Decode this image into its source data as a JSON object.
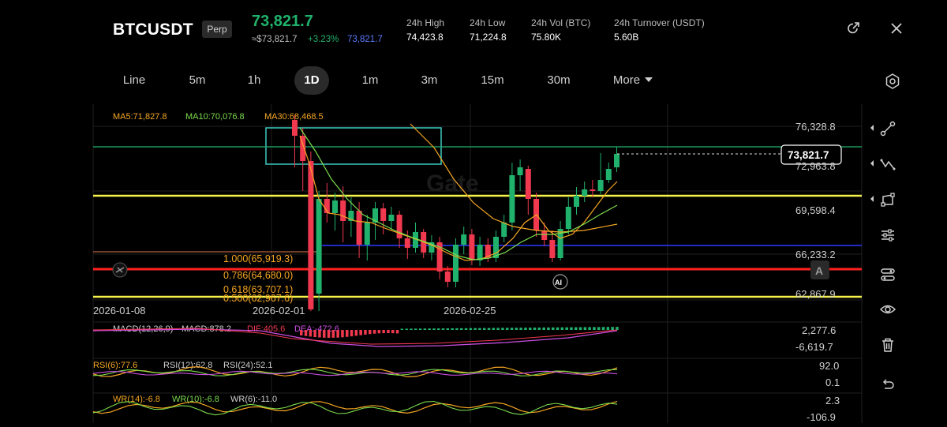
{
  "header": {
    "symbol": "BTCUSDT",
    "contract_type": "Perp",
    "last_price": "73,821.7",
    "approx_price": "≈$73,821.7",
    "change_pct": "+3.23%",
    "mark_price": "73,821.7",
    "stats": [
      {
        "label": "24h  High",
        "value": "74,423.8"
      },
      {
        "label": "24h  Low",
        "value": "71,224.8"
      },
      {
        "label": "24h  Vol (BTC)",
        "value": "75.80K"
      },
      {
        "label": "24h  Turnover (USDT)",
        "value": "5.60B"
      }
    ],
    "icons": {
      "share": "external-link-icon",
      "close": "close-icon"
    }
  },
  "intervals": {
    "items": [
      "Line",
      "5m",
      "1h",
      "1D",
      "1m",
      "3m",
      "15m",
      "30m"
    ],
    "active": "1D",
    "more_label": "More"
  },
  "main_chart": {
    "ma_labels": [
      {
        "text": "MA5:71,827.8",
        "color": "#f5a623"
      },
      {
        "text": "MA10:70,076.8",
        "color": "#7bdc4c"
      },
      {
        "text": "MA30:68,468.5",
        "color": "#f5a623"
      }
    ],
    "price_axis": [
      "76,328.8",
      "72,963.8",
      "69,598.4",
      "66,233.2",
      "62,867.9"
    ],
    "current_price_tag": "73,821.7",
    "date_axis": [
      "2026-01-08",
      "2026-02-01",
      "2026-02-25"
    ],
    "fib_labels": [
      "1.000(65,919.3)",
      "0.786(64,680.0)",
      "0.618(63,707.1)",
      "0.500(62,967.6)"
    ],
    "watermark": "Gate",
    "ai_badge": "AI",
    "a_badge": "A",
    "colors": {
      "up": "#20b26c",
      "down": "#f0394f",
      "ma5": "#f5a623",
      "ma10": "#7bdc4c"
    }
  },
  "macd_panel": {
    "labels": [
      {
        "text": "MACD(12,26,9)",
        "color": "#cfcfcf"
      },
      {
        "text": "MACD:878.2",
        "color": "#cfcfcf"
      },
      {
        "text": "DIF:405.6",
        "color": "#f0394f"
      },
      {
        "text": "DEA:-472.6",
        "color": "#c94ee0"
      }
    ],
    "axis": [
      "2,277.6",
      "-6,619.7"
    ]
  },
  "rsi_panel": {
    "labels": [
      {
        "text": "RSI(6):77.6",
        "color": "#f5a623"
      },
      {
        "text": "RSI(12):62.8",
        "color": "#cfcfcf"
      },
      {
        "text": "RSI(24):52.1",
        "color": "#cfcfcf"
      }
    ],
    "axis": [
      "92.0",
      "0.1"
    ]
  },
  "wr_panel": {
    "labels": [
      {
        "text": "WR(14):-6.8",
        "color": "#f5a623"
      },
      {
        "text": "WR(10):-6.8",
        "color": "#7bdc4c"
      },
      {
        "text": "WR(6):-11.0",
        "color": "#cfcfcf"
      }
    ],
    "axis": [
      "2.3",
      "-106.9"
    ]
  },
  "drawing_tools": [
    "trendline-icon",
    "zigzag-icon",
    "shape-icon",
    "settings-sliders-icon",
    "layers-icon",
    "eye-icon",
    "trash-icon",
    "undo-icon"
  ],
  "chart_data": {
    "type": "candlestick",
    "series": [
      {
        "name": "MA5",
        "value": 71827.8
      },
      {
        "name": "MA10",
        "value": 70076.8
      },
      {
        "name": "MA30",
        "value": 68468.5
      }
    ],
    "last": 73821.7,
    "x_dates": [
      "2026-01-08",
      "2026-02-01",
      "2026-02-25"
    ],
    "y_ticks": [
      76328.8,
      72963.8,
      69598.4,
      66233.2,
      62867.9
    ],
    "fibonacci": [
      {
        "level": 1.0,
        "price": 65919.3
      },
      {
        "level": 0.786,
        "price": 64680.0
      },
      {
        "level": 0.618,
        "price": 63707.1
      },
      {
        "level": 0.5,
        "price": 62967.6
      }
    ]
  }
}
